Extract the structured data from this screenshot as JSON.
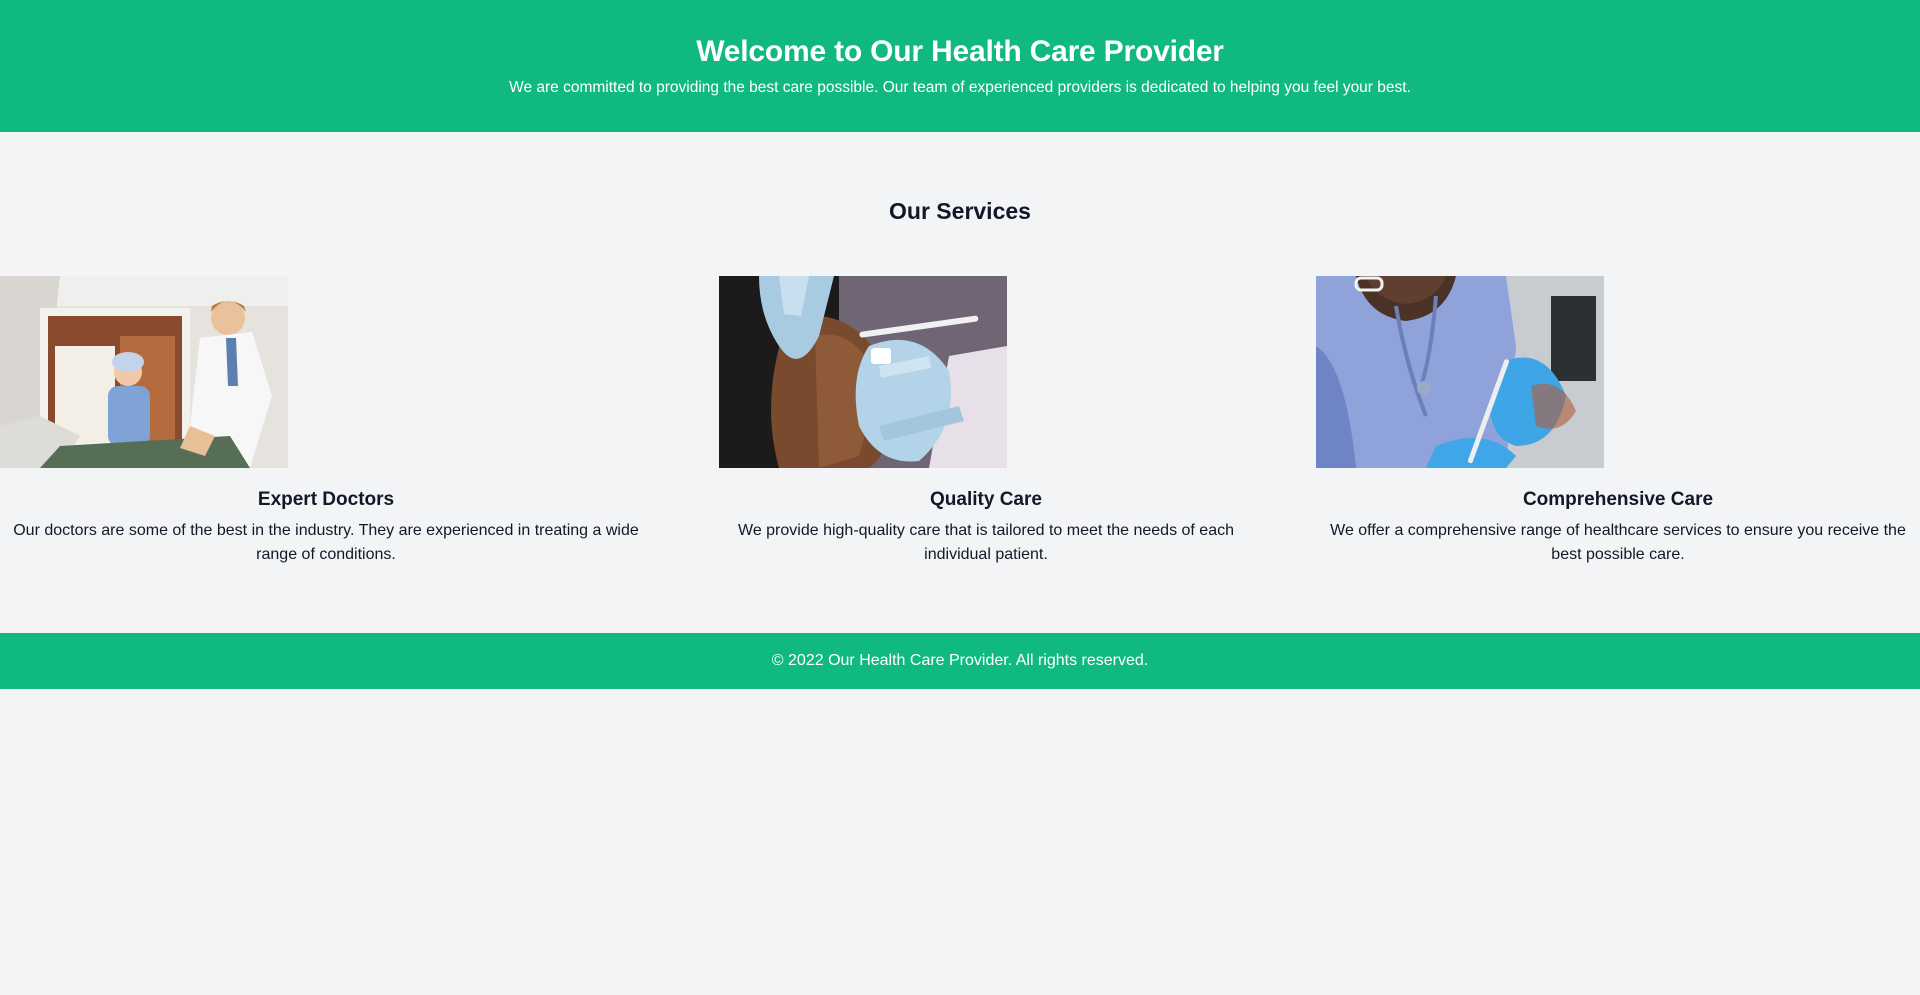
{
  "hero": {
    "title": "Welcome to Our Health Care Provider",
    "subtitle": "We are committed to providing the best care possible. Our team of experienced providers is dedicated to helping you feel your best."
  },
  "services": {
    "heading": "Our Services",
    "items": [
      {
        "title": "Expert Doctors",
        "description": "Our doctors are some of the best in the industry. They are experienced in treating a wide range of conditions."
      },
      {
        "title": "Quality Care",
        "description": "We provide high-quality care that is tailored to meet the needs of each individual patient."
      },
      {
        "title": "Comprehensive Care",
        "description": "We offer a comprehensive range of healthcare services to ensure you receive the best possible care."
      }
    ]
  },
  "footer": {
    "text": "© 2022 Our Health Care Provider. All rights reserved."
  },
  "colors": {
    "brand": "#10b981",
    "background": "#f3f4f6"
  }
}
